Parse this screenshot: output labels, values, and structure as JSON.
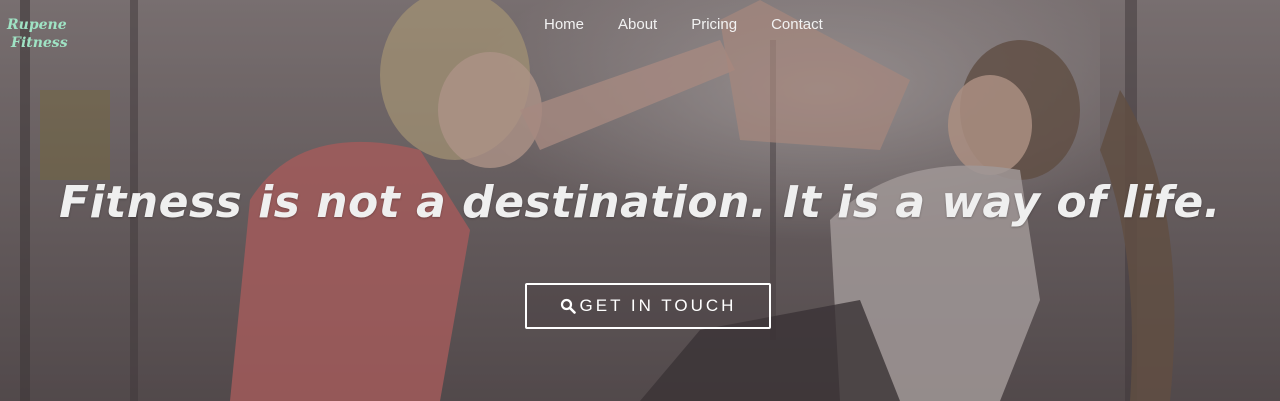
{
  "brand": {
    "line1": "Rupene",
    "line2": "Fitness",
    "color": "#9fe3c4"
  },
  "nav": {
    "items": [
      {
        "label": "Home"
      },
      {
        "label": "About"
      },
      {
        "label": "Pricing"
      },
      {
        "label": "Contact"
      }
    ]
  },
  "hero": {
    "headline": "Fitness is not a destination. It is a way of life.",
    "cta_label": "GET IN TOUCH",
    "cta_icon": "search-icon",
    "background": "photo-two-women-high-five-gym"
  }
}
